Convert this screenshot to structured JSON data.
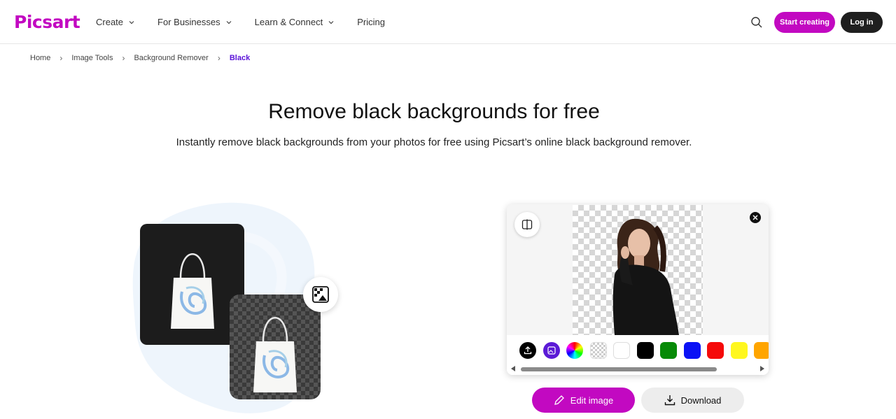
{
  "header": {
    "logo": "Picsart",
    "nav": [
      {
        "label": "Create",
        "has_dropdown": true
      },
      {
        "label": "For Businesses",
        "has_dropdown": true
      },
      {
        "label": "Learn & Connect",
        "has_dropdown": true
      },
      {
        "label": "Pricing",
        "has_dropdown": false
      }
    ],
    "search_icon": "search-icon",
    "start_label": "Start creating",
    "login_label": "Log in"
  },
  "breadcrumb": [
    "Home",
    "Image Tools",
    "Background Remover",
    "Black"
  ],
  "hero": {
    "title": "Remove black backgrounds for free",
    "subtitle": "Instantly remove black backgrounds from your photos for free using Picsart’s online black background remover."
  },
  "editor": {
    "swatches": [
      {
        "name": "upload",
        "color": "#000000"
      },
      {
        "name": "ai-background",
        "color": "#5b1ad6"
      },
      {
        "name": "color-wheel",
        "color": "rainbow"
      },
      {
        "name": "transparent",
        "color": "checker"
      },
      {
        "name": "white",
        "color": "#ffffff"
      },
      {
        "name": "black",
        "color": "#000000"
      },
      {
        "name": "green",
        "color": "#078a07"
      },
      {
        "name": "blue",
        "color": "#0a12f5"
      },
      {
        "name": "red",
        "color": "#f50a0a"
      },
      {
        "name": "yellow",
        "color": "#fff71f"
      },
      {
        "name": "orange",
        "color": "#ffa500"
      }
    ]
  },
  "actions": {
    "edit_label": "Edit image",
    "download_label": "Download"
  },
  "colors": {
    "brand": "#c209c1",
    "active_crumb": "#5a12d8",
    "dark_button": "#1f1f1f"
  }
}
